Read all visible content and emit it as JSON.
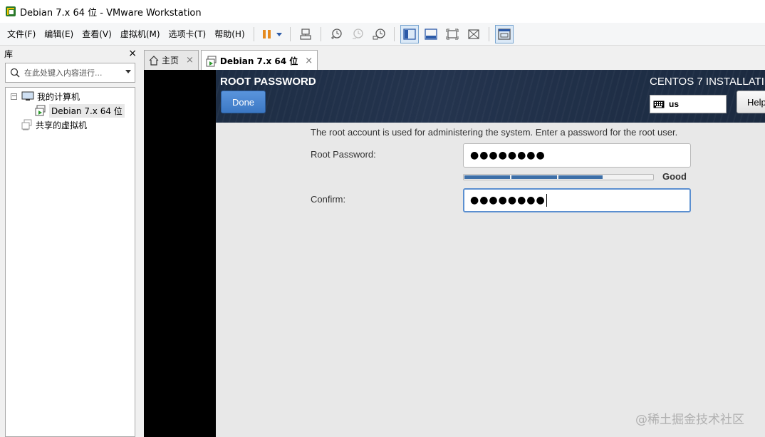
{
  "window": {
    "title": "Debian 7.x 64 位 - VMware Workstation"
  },
  "menu": {
    "items": [
      "文件(F)",
      "编辑(E)",
      "查看(V)",
      "虚拟机(M)",
      "选项卡(T)",
      "帮助(H)"
    ]
  },
  "toolbar": {
    "icons": [
      "pause-icon",
      "dropdown-icon",
      "send-ctrl-alt-del-icon",
      "snapshot-icon",
      "revert-snapshot-icon",
      "snapshot-manager-icon",
      "show-library-icon",
      "thumbnail-bar-icon",
      "full-screen-icon",
      "unity-icon",
      "console-view-icon"
    ]
  },
  "library": {
    "header": "库",
    "close": "×",
    "search_placeholder": "在此处键入内容进行...",
    "tree": {
      "root_toggle": "⊟",
      "root_label": "我的计算机",
      "vm_label": "Debian 7.x 64 位",
      "shared_label": "共享的虚拟机"
    }
  },
  "tabs": [
    {
      "label": "主页",
      "close": "×"
    },
    {
      "label": "Debian 7.x 64 位",
      "close": "×"
    }
  ],
  "installer": {
    "page_title": "ROOT PASSWORD",
    "done_button": "Done",
    "product_title": "CENTOS 7 INSTALLATI",
    "keyboard_layout": "us",
    "help_button": "Help",
    "description": "The root account is used for administering the system.  Enter a password for the root user.",
    "root_password_label": "Root Password:",
    "root_password_value": "●●●●●●●●",
    "confirm_label": "Confirm:",
    "confirm_value": "●●●●●●●●",
    "strength_label": "Good",
    "strength_level": 0.75,
    "strength_segments_filled": 3,
    "strength_segments_total": 4
  },
  "watermark": "@稀土掘金技术社区",
  "colors": {
    "installer_header": "#1d2d44",
    "done_button": "#3c78c4",
    "strength_bar": "#3d6fa8",
    "focus_border": "#5b8fd0"
  }
}
